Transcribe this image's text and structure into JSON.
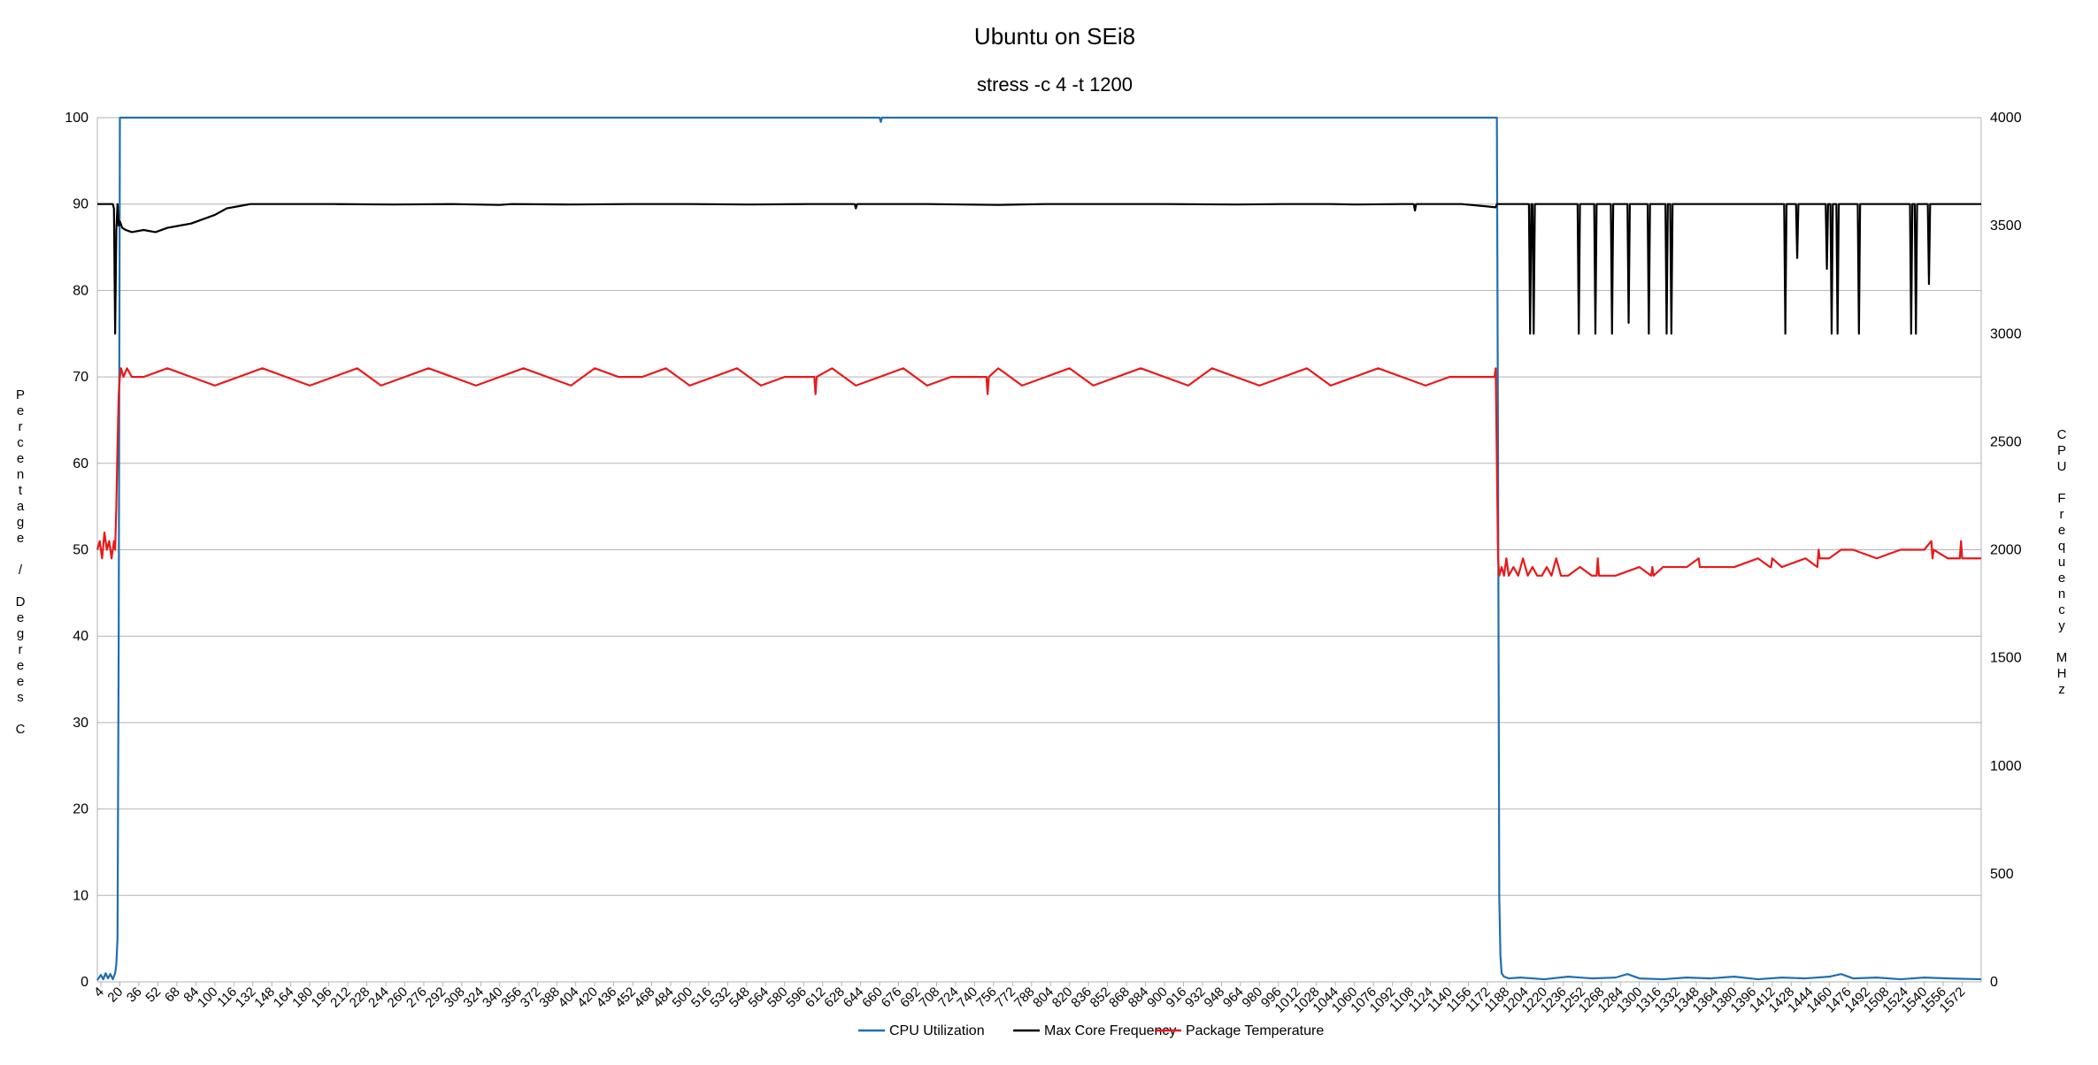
{
  "chart_data": {
    "type": "line",
    "title": "Ubuntu on SEi8",
    "subtitle": "stress -c 4 -t 1200",
    "ylabel_left": "Percentage / Degrees C",
    "ylabel_right": "CPU Frequency MHz",
    "xlabel": "",
    "y_left_range": [
      0,
      100
    ],
    "y_left_ticks": [
      0,
      10,
      20,
      30,
      40,
      50,
      60,
      70,
      80,
      90,
      100
    ],
    "y_right_range": [
      0,
      4000
    ],
    "y_right_ticks": [
      0,
      500,
      1000,
      1500,
      2000,
      2500,
      3000,
      3500,
      4000
    ],
    "x_range": [
      1,
      1588
    ],
    "x_ticks": [
      4,
      20,
      36,
      52,
      68,
      84,
      100,
      116,
      132,
      148,
      164,
      180,
      196,
      212,
      228,
      244,
      260,
      276,
      292,
      308,
      324,
      340,
      356,
      372,
      388,
      404,
      420,
      436,
      452,
      468,
      484,
      500,
      516,
      532,
      548,
      564,
      580,
      596,
      612,
      628,
      644,
      660,
      676,
      692,
      708,
      724,
      740,
      756,
      772,
      788,
      804,
      820,
      836,
      852,
      868,
      884,
      900,
      916,
      932,
      948,
      964,
      980,
      996,
      1012,
      1028,
      1044,
      1060,
      1076,
      1092,
      1108,
      1124,
      1140,
      1156,
      1172,
      1188,
      1204,
      1220,
      1236,
      1252,
      1268,
      1284,
      1300,
      1316,
      1332,
      1348,
      1364,
      1380,
      1396,
      1412,
      1428,
      1444,
      1460,
      1476,
      1492,
      1508,
      1524,
      1540,
      1556,
      1572
    ],
    "grid": "horizontal",
    "legend_position": "bottom",
    "series": [
      {
        "name": "CPU Utilization",
        "axis": "left",
        "color": "#1f6fb4",
        "x": [
          1,
          4,
          6,
          8,
          10,
          12,
          14,
          16,
          17,
          18,
          19,
          20,
          21,
          660,
          661,
          662,
          1180,
          1181,
          1182,
          1183,
          1184,
          1186,
          1190,
          1200,
          1220,
          1240,
          1260,
          1280,
          1290,
          1300,
          1320,
          1340,
          1360,
          1380,
          1400,
          1420,
          1440,
          1460,
          1470,
          1480,
          1500,
          1520,
          1540,
          1560,
          1588
        ],
        "values": [
          0.2,
          0.8,
          0.3,
          1.0,
          0.4,
          0.9,
          0.3,
          1.0,
          2.0,
          5.0,
          40.0,
          100,
          100,
          100,
          99.5,
          100,
          100,
          60.0,
          10.0,
          3.0,
          1.0,
          0.6,
          0.4,
          0.5,
          0.3,
          0.6,
          0.4,
          0.5,
          0.9,
          0.4,
          0.3,
          0.5,
          0.4,
          0.6,
          0.3,
          0.5,
          0.4,
          0.6,
          0.9,
          0.4,
          0.5,
          0.3,
          0.5,
          0.4,
          0.3
        ]
      },
      {
        "name": "Max Core Frequency",
        "axis": "right",
        "color": "#000000",
        "x": [
          1,
          14,
          15,
          16,
          17,
          18,
          19,
          20,
          22,
          25,
          30,
          40,
          50,
          60,
          70,
          80,
          90,
          100,
          110,
          120,
          130,
          160,
          200,
          250,
          300,
          340,
          350,
          400,
          450,
          500,
          550,
          600,
          639,
          640,
          641,
          700,
          760,
          800,
          900,
          960,
          1000,
          1040,
          1060,
          1100,
          1110,
          1111,
          1112,
          1150,
          1170,
          1179,
          1180,
          1200,
          1207,
          1208,
          1209,
          1210,
          1211,
          1212,
          1213,
          1214,
          1240,
          1248,
          1249,
          1250,
          1262,
          1263,
          1264,
          1276,
          1277,
          1278,
          1290,
          1291,
          1292,
          1307,
          1308,
          1309,
          1322,
          1323,
          1324,
          1326,
          1327,
          1328,
          1400,
          1422,
          1423,
          1424,
          1432,
          1433,
          1434,
          1457,
          1458,
          1459,
          1461,
          1462,
          1463,
          1466,
          1467,
          1468,
          1484,
          1485,
          1486,
          1528,
          1529,
          1530,
          1532,
          1533,
          1534,
          1543,
          1544,
          1545,
          1588
        ],
        "values": [
          3600,
          3600,
          3580,
          3000,
          3480,
          3600,
          3500,
          3520,
          3490,
          3480,
          3470,
          3480,
          3470,
          3490,
          3500,
          3510,
          3530,
          3550,
          3580,
          3590,
          3600,
          3600,
          3600,
          3598,
          3600,
          3596,
          3600,
          3598,
          3600,
          3600,
          3598,
          3600,
          3600,
          3580,
          3600,
          3600,
          3596,
          3600,
          3600,
          3598,
          3600,
          3600,
          3598,
          3600,
          3600,
          3570,
          3600,
          3600,
          3590,
          3585,
          3600,
          3600,
          3600,
          3000,
          3600,
          3600,
          3000,
          3600,
          3600,
          3600,
          3600,
          3600,
          3000,
          3600,
          3600,
          3000,
          3600,
          3600,
          3000,
          3600,
          3600,
          3050,
          3600,
          3600,
          3000,
          3600,
          3600,
          3000,
          3600,
          3600,
          3000,
          3600,
          3600,
          3600,
          3000,
          3600,
          3600,
          3350,
          3600,
          3600,
          3300,
          3600,
          3600,
          3000,
          3600,
          3600,
          3000,
          3600,
          3600,
          3000,
          3600,
          3600,
          3000,
          3600,
          3600,
          3000,
          3600,
          3600,
          3230,
          3600,
          3600
        ]
      },
      {
        "name": "Package Temperature",
        "axis": "left",
        "color": "#e8191b",
        "x": [
          1,
          3,
          5,
          7,
          9,
          11,
          13,
          15,
          16,
          17,
          18,
          19,
          20,
          21,
          23,
          26,
          30,
          40,
          60,
          80,
          100,
          120,
          140,
          160,
          180,
          200,
          220,
          240,
          260,
          280,
          300,
          320,
          340,
          360,
          380,
          400,
          420,
          440,
          460,
          480,
          500,
          520,
          540,
          560,
          580,
          600,
          605,
          606,
          607,
          620,
          640,
          660,
          680,
          700,
          720,
          740,
          750,
          751,
          752,
          760,
          780,
          800,
          820,
          840,
          860,
          880,
          900,
          920,
          940,
          960,
          980,
          1000,
          1020,
          1040,
          1060,
          1080,
          1100,
          1120,
          1140,
          1160,
          1178,
          1179,
          1180,
          1181,
          1182,
          1184,
          1186,
          1188,
          1190,
          1194,
          1198,
          1202,
          1206,
          1210,
          1214,
          1218,
          1222,
          1226,
          1230,
          1234,
          1240,
          1250,
          1260,
          1264,
          1265,
          1266,
          1280,
          1300,
          1310,
          1311,
          1312,
          1320,
          1340,
          1350,
          1351,
          1352,
          1380,
          1400,
          1410,
          1411,
          1412,
          1420,
          1440,
          1450,
          1451,
          1452,
          1460,
          1470,
          1480,
          1500,
          1520,
          1540,
          1546,
          1547,
          1548,
          1560,
          1570,
          1571,
          1572,
          1588
        ],
        "values": [
          50,
          51,
          49,
          52,
          50,
          51,
          49,
          51,
          50,
          55,
          62,
          68,
          70,
          71,
          70,
          71,
          70,
          70,
          71,
          70,
          69,
          70,
          71,
          70,
          69,
          70,
          71,
          69,
          70,
          71,
          70,
          69,
          70,
          71,
          70,
          69,
          71,
          70,
          70,
          71,
          69,
          70,
          71,
          69,
          70,
          70,
          70,
          68,
          70,
          71,
          69,
          70,
          71,
          69,
          70,
          70,
          70,
          68,
          70,
          71,
          69,
          70,
          71,
          69,
          70,
          71,
          70,
          69,
          71,
          70,
          69,
          70,
          71,
          69,
          70,
          71,
          70,
          69,
          70,
          70,
          70,
          71,
          60,
          49,
          47,
          48,
          47,
          49,
          47,
          48,
          47,
          49,
          47,
          48,
          47,
          47,
          48,
          47,
          49,
          47,
          47,
          48,
          47,
          47,
          49,
          47,
          47,
          48,
          47,
          48,
          47,
          48,
          48,
          49,
          48,
          48,
          48,
          49,
          48,
          48,
          49,
          48,
          49,
          48,
          50,
          49,
          49,
          50,
          50,
          49,
          50,
          50,
          51,
          49,
          50,
          49,
          49,
          51,
          49,
          49
        ]
      }
    ]
  }
}
